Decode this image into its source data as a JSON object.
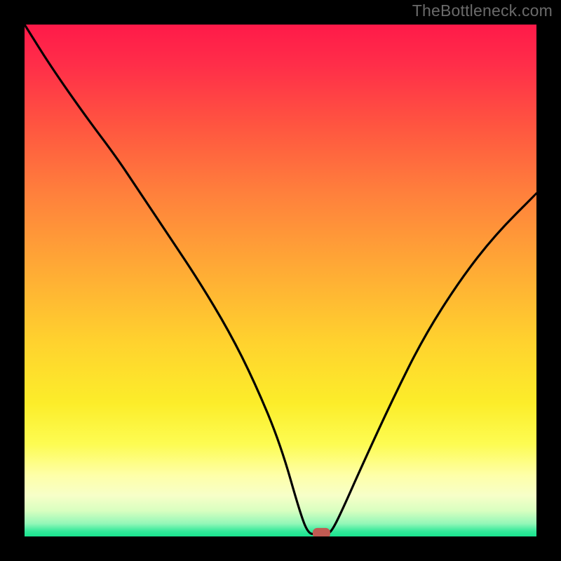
{
  "watermark": "TheBottleneck.com",
  "chart_data": {
    "type": "line",
    "title": "",
    "xlabel": "",
    "ylabel": "",
    "xlim": [
      0,
      100
    ],
    "ylim": [
      0,
      100
    ],
    "grid": false,
    "series": [
      {
        "name": "bottleneck-curve",
        "x": [
          0,
          5,
          12,
          18,
          22,
          28,
          34,
          40,
          45,
          50,
          54,
          55.5,
          57,
          59,
          60,
          62,
          66,
          72,
          78,
          85,
          92,
          100
        ],
        "values": [
          100,
          92,
          82,
          74,
          68,
          59,
          50,
          40,
          30,
          18,
          4,
          0.5,
          0.5,
          0.5,
          1,
          5,
          14,
          27,
          39,
          50,
          59,
          67
        ]
      }
    ],
    "marker": {
      "x": 58,
      "y": 0.5,
      "shape": "rounded-rect",
      "color": "#c05a52"
    },
    "background_gradient": {
      "top": "#ff1a49",
      "mid": "#ffd22e",
      "bottom": "#19e38f"
    }
  }
}
